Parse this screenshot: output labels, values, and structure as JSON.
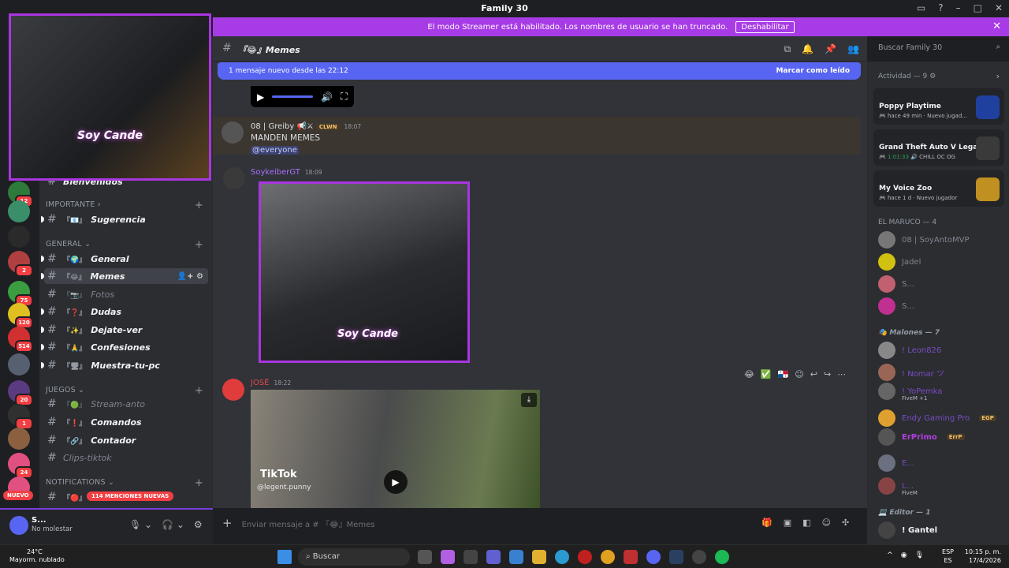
{
  "window": {
    "title": "Family 30"
  },
  "banner": {
    "text": "El modo Streamer está habilitado. Los nombres de usuario se han truncado.",
    "button": "Deshabilitar"
  },
  "rail": {
    "nuevo": "NUEVO",
    "badges": [
      "12",
      "2",
      "75",
      "120",
      "514",
      "20",
      "1",
      "24"
    ]
  },
  "sidebar": {
    "cut_channel": "Bienvenidos",
    "categories": [
      {
        "name": "IMPORTANTE",
        "channels": [
          {
            "emo": "『📧』",
            "label": "Sugerencia"
          }
        ]
      },
      {
        "name": "GENERAL",
        "channels": [
          {
            "emo": "『🌍』",
            "label": "General"
          },
          {
            "emo": "『😂』",
            "label": "Memes"
          },
          {
            "emo": "『📷』",
            "label": "Fotos"
          },
          {
            "emo": "『❓』",
            "label": "Dudas"
          },
          {
            "emo": "『✨』",
            "label": "Dejate-ver"
          },
          {
            "emo": "『🙏』",
            "label": "Confesiones"
          },
          {
            "emo": "『🖥』",
            "label": "Muestra-tu-pc"
          }
        ]
      },
      {
        "name": "JUEGOS",
        "channels": [
          {
            "emo": "『🟢』",
            "label": "Stream-anto"
          },
          {
            "emo": "『❗』",
            "label": "Comandos"
          },
          {
            "emo": "『🔗』",
            "label": "Contador"
          },
          {
            "emo": "",
            "label": "Clips-tiktok"
          }
        ]
      },
      {
        "name": "NOTIFICATIONS",
        "channels": []
      }
    ],
    "mentions_pill": "114 MENCIONES NUEVAS"
  },
  "user": {
    "name": "S...",
    "status": "No molestar"
  },
  "webcam": {
    "label": "Soy Cande"
  },
  "chat": {
    "channel": "『😂』Memes",
    "new_messages": "1 mensaje nuevo desde las 22:12",
    "mark_read": "Marcar como leído",
    "messages": [
      {
        "user": "08 | Greiby",
        "tag": "CLWN",
        "time": "18:07",
        "text": "MANDEN MEMES",
        "mention": "@everyone"
      },
      {
        "user": "SoykeiberGT",
        "time": "18:09",
        "image_label": "Soy Cande"
      },
      {
        "user": "JOSÉ",
        "time": "18:22",
        "video_brand": "TikTok",
        "video_handle": "@legent.punny"
      }
    ],
    "composer": "Enviar mensaje a # 『😂』Memes"
  },
  "search": {
    "placeholder": "Buscar Family 30"
  },
  "members": {
    "activity_header": "Actividad — 9",
    "activities": [
      {
        "game": "Poppy Playtime",
        "sub": "hace 49 min",
        "sub2": "Nuevo jugad..."
      },
      {
        "game": "Grand Theft Auto V Legacy",
        "sub": "1:01:33",
        "sub2": "CHILL OC OG"
      },
      {
        "game": "My Voice Zoo",
        "sub": "hace 1 d",
        "sub2": "Nuevo jugador"
      }
    ],
    "groups": [
      {
        "name": "EL MARUCO — 4",
        "list": [
          "08 | SoyAntoMVP",
          "Jadel",
          "S...",
          "S..."
        ]
      },
      {
        "name": "Malones — 7",
        "list": [
          "! Leon826",
          "! Nomar ツ",
          "! YoPemka",
          "Endy Gaming Pro",
          "ErPrimo",
          "E...",
          "L..."
        ]
      },
      {
        "name": "Editor — 1",
        "list": [
          "! Gantel"
        ]
      }
    ],
    "subs": {
      "yopemka": "FiveM +1",
      "l": "FiveM"
    },
    "tags": {
      "endy": "EGP",
      "erprimo": "ErrP"
    }
  },
  "taskbar": {
    "temp": "24°C",
    "weather": "Mayorm. nublado",
    "search": "Buscar",
    "lang1": "ESP",
    "lang2": "ES",
    "time": "10:15 p. m.",
    "date": "17/4/2026"
  },
  "colors": {
    "accent": "#5865f2",
    "streamer": "#a73be6",
    "webcam_border": "#a936e0"
  }
}
